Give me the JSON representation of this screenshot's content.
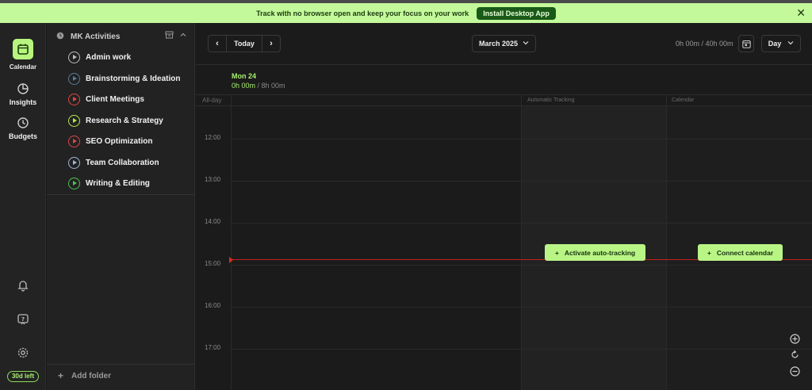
{
  "banner": {
    "text": "Track with no browser open and keep your focus on your work",
    "button": "Install Desktop App",
    "close": "✕"
  },
  "rail": {
    "calendar": "Calendar",
    "insights": "Insights",
    "budgets": "Budgets",
    "trial": "30d left"
  },
  "sidebar": {
    "folder": "MK Activities",
    "activities": [
      {
        "label": "Admin work",
        "color": "#bdbdbd"
      },
      {
        "label": "Brainstorming & Ideation",
        "color": "#5b7a9a"
      },
      {
        "label": "Client Meetings",
        "color": "#e04545"
      },
      {
        "label": "Research & Strategy",
        "color": "#b6e84a"
      },
      {
        "label": "SEO Optimization",
        "color": "#e04545"
      },
      {
        "label": "Team Collaboration",
        "color": "#9fb8d8"
      },
      {
        "label": "Writing & Editing",
        "color": "#4fc04f"
      }
    ],
    "add_folder": "Add folder"
  },
  "toolbar": {
    "prev": "‹",
    "today": "Today",
    "next": "›",
    "month": "March 2025",
    "totals": "0h 00m / 40h 00m",
    "view": "Day"
  },
  "day": {
    "name": "Mon 24",
    "tracked": "0h 00m",
    "planned": " / 8h 00m",
    "all_day": "All-day",
    "col_auto": "Automatic Tracking",
    "col_calendar": "Calendar"
  },
  "hours": [
    "12:00",
    "13:00",
    "14:00",
    "15:00",
    "16:00",
    "17:00"
  ],
  "actions": {
    "auto_tracking": "Activate auto-tracking",
    "connect_calendar": "Connect calendar"
  }
}
